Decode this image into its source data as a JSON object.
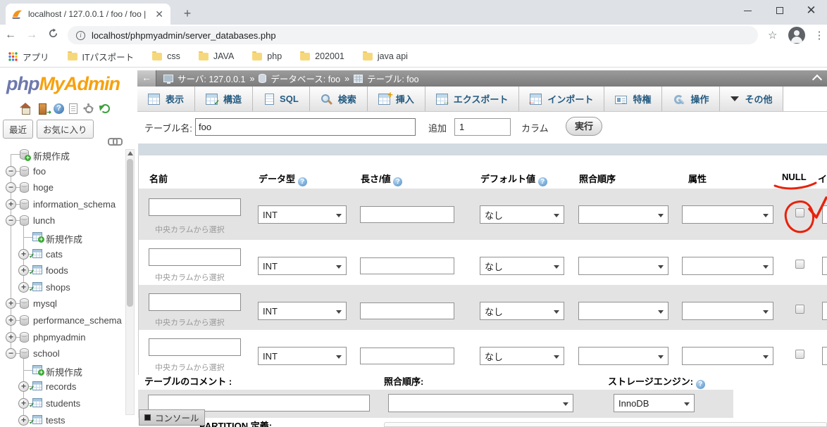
{
  "colors": {
    "logo_blue": "#6d79ad",
    "logo_orange": "#f7a10e",
    "annotation_red": "#e8220c",
    "tab_text_blue": "#235a81",
    "row_stripe_gray": "#e3e3e3",
    "header_strip_blue": "#d3dbe2"
  },
  "browser": {
    "tab_title": "localhost / 127.0.0.1 / foo / foo |",
    "url": "localhost/phpmyadmin/server_databases.php",
    "bookmarks": {
      "apps_label": "アプリ",
      "folders": [
        "ITパスポート",
        "css",
        "JAVA",
        "php",
        "202001",
        "java api"
      ]
    }
  },
  "pma": {
    "logo_php": "php",
    "logo_rest": "MyAdmin",
    "recent_label": "最近",
    "favorites_label": "お気に入り",
    "tree": [
      {
        "label": "新規作成",
        "icon": "database-new",
        "toggle": null,
        "level": 0
      },
      {
        "label": "foo",
        "icon": "database",
        "toggle": "minus",
        "level": 0
      },
      {
        "label": "hoge",
        "icon": "database",
        "toggle": "minus",
        "level": 0
      },
      {
        "label": "information_schema",
        "icon": "database",
        "toggle": "plus",
        "level": 0
      },
      {
        "label": "lunch",
        "icon": "database",
        "toggle": "minus",
        "level": 0
      },
      {
        "label": "新規作成",
        "icon": "table-new",
        "toggle": null,
        "level": 1
      },
      {
        "label": "cats",
        "icon": "table",
        "toggle": "plus",
        "level": 1
      },
      {
        "label": "foods",
        "icon": "table",
        "toggle": "plus",
        "level": 1
      },
      {
        "label": "shops",
        "icon": "table",
        "toggle": "plus",
        "level": 1
      },
      {
        "label": "mysql",
        "icon": "database",
        "toggle": "plus",
        "level": 0
      },
      {
        "label": "performance_schema",
        "icon": "database",
        "toggle": "plus",
        "level": 0
      },
      {
        "label": "phpmyadmin",
        "icon": "database",
        "toggle": "plus",
        "level": 0
      },
      {
        "label": "school",
        "icon": "database",
        "toggle": "minus",
        "level": 0
      },
      {
        "label": "新規作成",
        "icon": "table-new",
        "toggle": null,
        "level": 1
      },
      {
        "label": "records",
        "icon": "table",
        "toggle": "plus",
        "level": 1
      },
      {
        "label": "students",
        "icon": "table",
        "toggle": "plus",
        "level": 1
      },
      {
        "label": "tests",
        "icon": "table",
        "toggle": "plus",
        "level": 1
      }
    ]
  },
  "breadcrumb": {
    "server": "サーバ: 127.0.0.1",
    "sep1": "»",
    "database": "データベース: foo",
    "sep2": "»",
    "table": "テーブル: foo"
  },
  "tabs": [
    {
      "label": "表示"
    },
    {
      "label": "構造"
    },
    {
      "label": "SQL"
    },
    {
      "label": "検索"
    },
    {
      "label": "挿入"
    },
    {
      "label": "エクスポート"
    },
    {
      "label": "インポート"
    },
    {
      "label": "特権"
    },
    {
      "label": "操作"
    },
    {
      "label": "その他"
    }
  ],
  "namerow": {
    "label": "テーブル名:",
    "value": "foo",
    "add_label": "追加",
    "count_value": "1",
    "columns_label": "カラム",
    "go_label": "実行"
  },
  "header_cols": {
    "c0": "名前",
    "c1": "データ型",
    "c2": "長さ/値",
    "c3": "デフォルト値",
    "c4": "照合順序",
    "c5": "属性",
    "c6": "NULL",
    "c7": "イ"
  },
  "rows": [
    {
      "name": "",
      "type": "INT",
      "length": "",
      "default": "なし",
      "collation": "",
      "attributes": "",
      "picker": "中央カラムから選択"
    },
    {
      "name": "",
      "type": "INT",
      "length": "",
      "default": "なし",
      "collation": "",
      "attributes": "",
      "picker": "中央カラムから選択"
    },
    {
      "name": "",
      "type": "INT",
      "length": "",
      "default": "なし",
      "collation": "",
      "attributes": "",
      "picker": "中央カラムから選択"
    },
    {
      "name": "",
      "type": "INT",
      "length": "",
      "default": "なし",
      "collation": "",
      "attributes": "",
      "picker": "中央カラムから選択"
    }
  ],
  "footer": {
    "comment_label": "テーブルのコメント :",
    "comment_value": "",
    "collation_label": "照合順序:",
    "collation_value": "",
    "engine_label": "ストレージエンジン:",
    "engine_value": "InnoDB",
    "partial_label": "PARTITION 定義:"
  },
  "console_label": "コンソール"
}
